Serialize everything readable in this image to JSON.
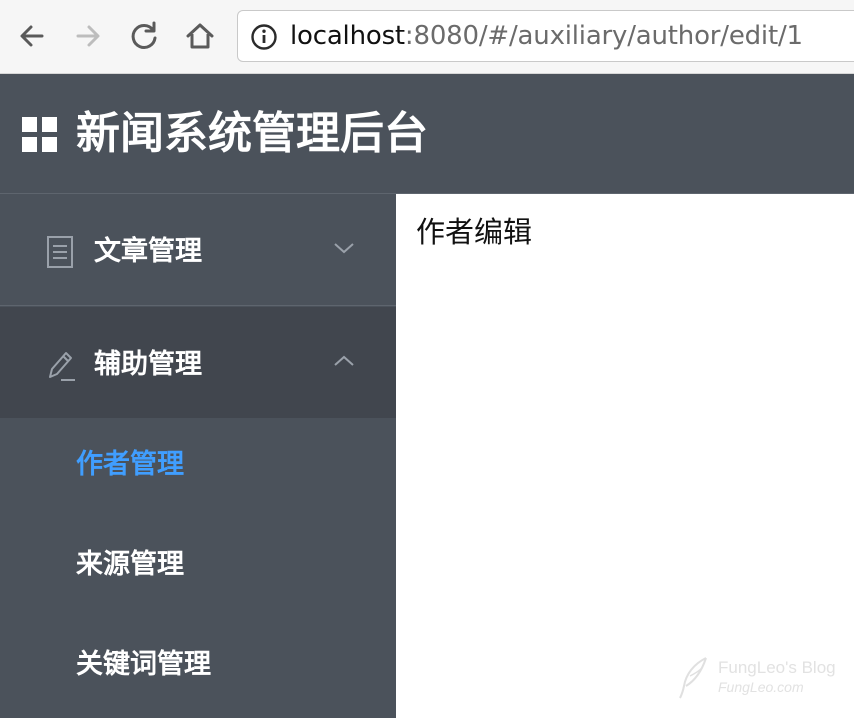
{
  "browser": {
    "url_host": "localhost",
    "url_rest": ":8080/#/auxiliary/author/edit/1",
    "icons": [
      "back-icon",
      "forward-icon",
      "reload-icon",
      "home-icon",
      "info-icon"
    ]
  },
  "header": {
    "title": "新闻系统管理后台",
    "logo_icon": "grid-icon"
  },
  "sidebar": {
    "groups": [
      {
        "label": "文章管理",
        "icon": "document-icon",
        "expanded": false
      },
      {
        "label": "辅助管理",
        "icon": "edit-pencil-icon",
        "expanded": true,
        "items": [
          {
            "label": "作者管理",
            "active": true
          },
          {
            "label": "来源管理",
            "active": false
          },
          {
            "label": "关键词管理",
            "active": false
          }
        ]
      }
    ]
  },
  "content": {
    "title": "作者编辑"
  },
  "watermark": {
    "line1": "FungLeo's Blog",
    "line2": "FungLeo.com"
  },
  "colors": {
    "chrome_bg": "#f6f6f6",
    "sidebar_bg": "#4b525b",
    "sidebar_group_active_bg": "#41464e",
    "active_item": "#409eff",
    "text_light": "#ffffff"
  }
}
